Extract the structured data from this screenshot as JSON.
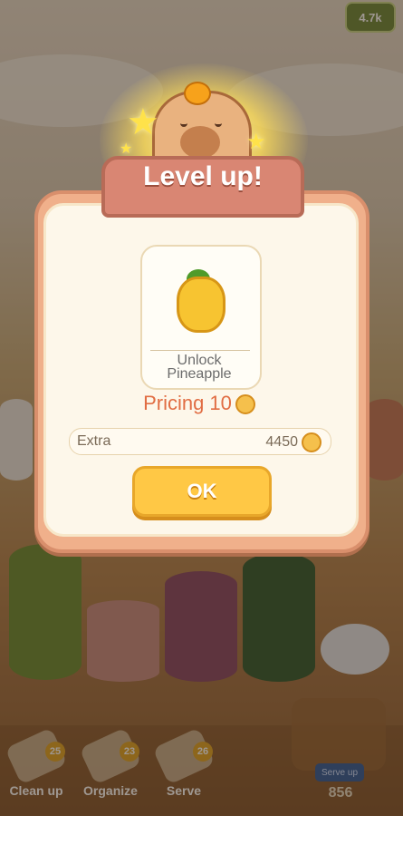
{
  "hud": {
    "coins_label": "4.7k"
  },
  "dialog": {
    "title": "Level up!",
    "unlock_line1": "Unlock",
    "unlock_line2": "Pineapple",
    "pricing_label": "Pricing 10",
    "extra_label": "Extra",
    "extra_value": "4450",
    "ok_label": "OK"
  },
  "toolbar": {
    "tools": [
      {
        "label": "Clean up",
        "count": "25"
      },
      {
        "label": "Organize",
        "count": "23"
      },
      {
        "label": "Serve",
        "count": "26"
      }
    ],
    "serve_up_label": "Serve up",
    "serve_up_count": "856"
  },
  "colors": {
    "accent": "#e16d43",
    "button": "#ffc845",
    "dialog_frame": "#f0b08b"
  }
}
